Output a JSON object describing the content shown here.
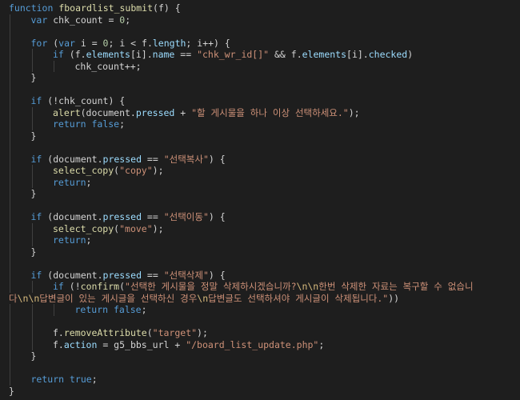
{
  "editor": {
    "language": "javascript",
    "colors": {
      "background": "#1e1e1e",
      "keyword": "#569cd6",
      "function": "#dcdcaa",
      "string": "#ce9178",
      "number": "#b5cea8",
      "property": "#9cdcfe",
      "plain": "#d4d4d4",
      "indent_guide": "#404040"
    },
    "lines": [
      {
        "indent": 0,
        "tokens": [
          [
            "kw",
            "function"
          ],
          [
            "pl",
            " "
          ],
          [
            "fn",
            "fboardlist_submit"
          ],
          [
            "pl",
            "(f) {"
          ]
        ]
      },
      {
        "indent": 1,
        "tokens": [
          [
            "kw",
            "var"
          ],
          [
            "pl",
            " chk_count = "
          ],
          [
            "num",
            "0"
          ],
          [
            "pl",
            ";"
          ]
        ]
      },
      {
        "indent": 0,
        "tokens": []
      },
      {
        "indent": 1,
        "tokens": [
          [
            "kw",
            "for"
          ],
          [
            "pl",
            " ("
          ],
          [
            "kw",
            "var"
          ],
          [
            "pl",
            " i = "
          ],
          [
            "num",
            "0"
          ],
          [
            "pl",
            "; i < f."
          ],
          [
            "prop",
            "length"
          ],
          [
            "pl",
            "; i++) {"
          ]
        ]
      },
      {
        "indent": 2,
        "tokens": [
          [
            "kw",
            "if"
          ],
          [
            "pl",
            " (f."
          ],
          [
            "prop",
            "elements"
          ],
          [
            "pl",
            "[i]."
          ],
          [
            "prop",
            "name"
          ],
          [
            "pl",
            " == "
          ],
          [
            "str",
            "\"chk_wr_id[]\""
          ],
          [
            "pl",
            " && f."
          ],
          [
            "prop",
            "elements"
          ],
          [
            "pl",
            "[i]."
          ],
          [
            "prop",
            "checked"
          ],
          [
            "pl",
            ")"
          ]
        ]
      },
      {
        "indent": 3,
        "tokens": [
          [
            "pl",
            "chk_count++;"
          ]
        ]
      },
      {
        "indent": 1,
        "tokens": [
          [
            "pl",
            "}"
          ]
        ]
      },
      {
        "indent": 0,
        "tokens": []
      },
      {
        "indent": 1,
        "tokens": [
          [
            "kw",
            "if"
          ],
          [
            "pl",
            " (!chk_count) {"
          ]
        ]
      },
      {
        "indent": 2,
        "tokens": [
          [
            "fn",
            "alert"
          ],
          [
            "pl",
            "(document."
          ],
          [
            "prop",
            "pressed"
          ],
          [
            "pl",
            " + "
          ],
          [
            "str",
            "\"할 게시물을 하나 이상 선택하세요.\""
          ],
          [
            "pl",
            ");"
          ]
        ]
      },
      {
        "indent": 2,
        "tokens": [
          [
            "kw",
            "return"
          ],
          [
            "pl",
            " "
          ],
          [
            "kw",
            "false"
          ],
          [
            "pl",
            ";"
          ]
        ]
      },
      {
        "indent": 1,
        "tokens": [
          [
            "pl",
            "}"
          ]
        ]
      },
      {
        "indent": 0,
        "tokens": []
      },
      {
        "indent": 1,
        "tokens": [
          [
            "kw",
            "if"
          ],
          [
            "pl",
            " (document."
          ],
          [
            "prop",
            "pressed"
          ],
          [
            "pl",
            " == "
          ],
          [
            "str",
            "\"선택복사\""
          ],
          [
            "pl",
            ") {"
          ]
        ]
      },
      {
        "indent": 2,
        "tokens": [
          [
            "fn",
            "select_copy"
          ],
          [
            "pl",
            "("
          ],
          [
            "str",
            "\"copy\""
          ],
          [
            "pl",
            ");"
          ]
        ]
      },
      {
        "indent": 2,
        "tokens": [
          [
            "kw",
            "return"
          ],
          [
            "pl",
            ";"
          ]
        ]
      },
      {
        "indent": 1,
        "tokens": [
          [
            "pl",
            "}"
          ]
        ]
      },
      {
        "indent": 0,
        "tokens": []
      },
      {
        "indent": 1,
        "tokens": [
          [
            "kw",
            "if"
          ],
          [
            "pl",
            " (document."
          ],
          [
            "prop",
            "pressed"
          ],
          [
            "pl",
            " == "
          ],
          [
            "str",
            "\"선택이동\""
          ],
          [
            "pl",
            ") {"
          ]
        ]
      },
      {
        "indent": 2,
        "tokens": [
          [
            "fn",
            "select_copy"
          ],
          [
            "pl",
            "("
          ],
          [
            "str",
            "\"move\""
          ],
          [
            "pl",
            ");"
          ]
        ]
      },
      {
        "indent": 2,
        "tokens": [
          [
            "kw",
            "return"
          ],
          [
            "pl",
            ";"
          ]
        ]
      },
      {
        "indent": 1,
        "tokens": [
          [
            "pl",
            "}"
          ]
        ]
      },
      {
        "indent": 0,
        "tokens": []
      },
      {
        "indent": 1,
        "tokens": [
          [
            "kw",
            "if"
          ],
          [
            "pl",
            " (document."
          ],
          [
            "prop",
            "pressed"
          ],
          [
            "pl",
            " == "
          ],
          [
            "str",
            "\"선택삭제\""
          ],
          [
            "pl",
            ") {"
          ]
        ]
      },
      {
        "indent": 2,
        "tokens": [
          [
            "kw",
            "if"
          ],
          [
            "pl",
            " (!"
          ],
          [
            "fn",
            "confirm"
          ],
          [
            "pl",
            "("
          ],
          [
            "str",
            "\"선택한 게시물을 정말 삭제하시겠습니까?"
          ],
          [
            "esc",
            "\\n\\n"
          ],
          [
            "str",
            "한번 삭제한 자료는 복구할 수 없습니"
          ]
        ]
      },
      {
        "indent": 0,
        "tokens": [
          [
            "str",
            "다"
          ],
          [
            "esc",
            "\\n\\n"
          ],
          [
            "str",
            "답변글이 있는 게시글을 선택하신 경우"
          ],
          [
            "esc",
            "\\n"
          ],
          [
            "str",
            "답변글도 선택하셔야 게시글이 삭제됩니다.\""
          ],
          [
            "pl",
            "))"
          ]
        ]
      },
      {
        "indent": 3,
        "tokens": [
          [
            "kw",
            "return"
          ],
          [
            "pl",
            " "
          ],
          [
            "kw",
            "false"
          ],
          [
            "pl",
            ";"
          ]
        ]
      },
      {
        "indent": 0,
        "tokens": []
      },
      {
        "indent": 2,
        "tokens": [
          [
            "pl",
            "f."
          ],
          [
            "fn",
            "removeAttribute"
          ],
          [
            "pl",
            "("
          ],
          [
            "str",
            "\"target\""
          ],
          [
            "pl",
            ");"
          ]
        ]
      },
      {
        "indent": 2,
        "tokens": [
          [
            "pl",
            "f."
          ],
          [
            "prop",
            "action"
          ],
          [
            "pl",
            " = g5_bbs_url + "
          ],
          [
            "str",
            "\"/board_list_update.php\""
          ],
          [
            "pl",
            ";"
          ]
        ]
      },
      {
        "indent": 1,
        "tokens": [
          [
            "pl",
            "}"
          ]
        ]
      },
      {
        "indent": 0,
        "tokens": []
      },
      {
        "indent": 1,
        "tokens": [
          [
            "kw",
            "return"
          ],
          [
            "pl",
            " "
          ],
          [
            "kw",
            "true"
          ],
          [
            "pl",
            ";"
          ]
        ]
      },
      {
        "indent": 0,
        "tokens": [
          [
            "pl",
            "}"
          ]
        ]
      }
    ]
  }
}
